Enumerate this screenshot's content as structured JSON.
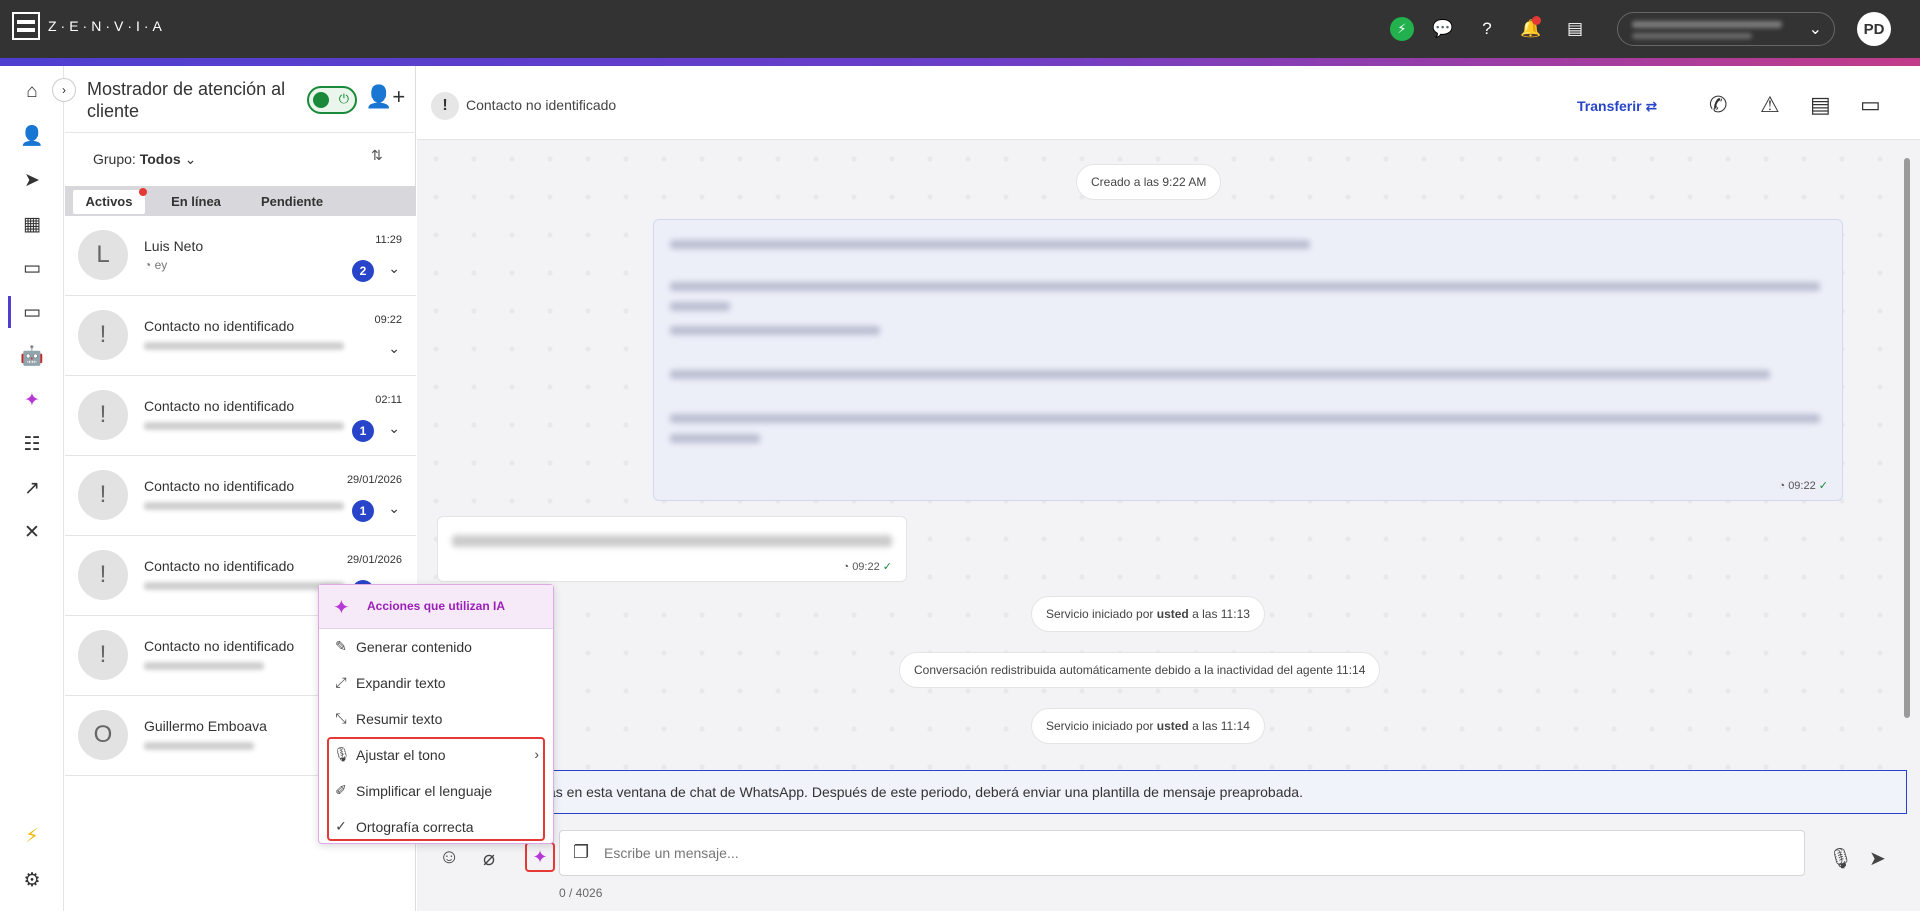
{
  "topbar": {
    "logo_text": "Z·E·N·V·I·A",
    "icons": [
      "lightning-icon",
      "chat-bubbles-icon",
      "help-icon",
      "bell-icon",
      "store-icon"
    ],
    "avatar_initials": "PD",
    "colors": {
      "bar": "#333333",
      "accent_start": "#4e3fd0",
      "accent_end": "#c23c8a"
    }
  },
  "leftnav": {
    "items": [
      "home-icon",
      "contacts-icon",
      "send-icon",
      "document-icon",
      "chat-icon",
      "ticket-icon",
      "robot-icon",
      "ai-sparkle-icon",
      "workflow-icon",
      "analytics-icon",
      "tools-icon"
    ],
    "bottom": [
      "lightning-icon",
      "settings-icon"
    ]
  },
  "list_panel": {
    "title": "Mostrador de atención al cliente",
    "group_label": "Grupo:",
    "group_value": "Todos",
    "tabs": [
      {
        "label": "Activos",
        "active": true,
        "dot": true
      },
      {
        "label": "En línea",
        "active": false
      },
      {
        "label": "Pendiente",
        "active": false
      }
    ],
    "conversations": [
      {
        "initial": "L",
        "name": "Luis Neto",
        "preview": "ey",
        "time": "11:29",
        "badge": "2",
        "channel": "whatsapp"
      },
      {
        "initial": "!",
        "name": "Contacto no identificado",
        "preview": "",
        "time": "09:22",
        "badge": ""
      },
      {
        "initial": "!",
        "name": "Contacto no identificado",
        "preview": "",
        "time": "02:11",
        "badge": "1"
      },
      {
        "initial": "!",
        "name": "Contacto no identificado",
        "preview": "",
        "time": "29/01/2026",
        "badge": "1"
      },
      {
        "initial": "!",
        "name": "Contacto no identificado",
        "preview": "",
        "time": "29/01/2026",
        "badge": "1"
      },
      {
        "initial": "!",
        "name": "Contacto no identificado",
        "preview": "",
        "time": "",
        "badge": ""
      },
      {
        "initial": "O",
        "name": "Guillermo Emboava",
        "preview": "",
        "time": "",
        "badge": ""
      }
    ]
  },
  "chat": {
    "header_title": "Contacto no identificado",
    "transfer_label": "Transferir",
    "header_icons": [
      "phone-icon",
      "alert-icon",
      "archive-icon",
      "ticket-icon"
    ],
    "created_label": "Creado a las 9:22 AM",
    "out_message_time": "09:22",
    "in_message_time": "09:22",
    "system_messages": [
      {
        "prefix": "Servicio iniciado por",
        "bold": "usted",
        "suffix": "a las 11:13"
      },
      {
        "text": "Conversación redistribuida automáticamente debido a la inactividad del agente 11:14"
      },
      {
        "prefix": "Servicio iniciado por",
        "bold": "usted",
        "suffix": "a las 11:14"
      }
    ],
    "notice": "as en esta ventana de chat de WhatsApp. Después de este periodo, deberá enviar una plantilla de mensaje preaprobada.",
    "input_placeholder": "Escribe un mensaje...",
    "char_counter": "0 / 4026"
  },
  "ai_menu": {
    "header": "Acciones que utilizan IA",
    "options": [
      {
        "label": "Generar contenido",
        "icon": "edit-icon"
      },
      {
        "label": "Expandir texto",
        "icon": "expand-icon"
      },
      {
        "label": "Resumir texto",
        "icon": "collapse-icon"
      },
      {
        "label": "Ajustar el tono",
        "icon": "microphone-icon",
        "submenu": true
      },
      {
        "label": "Simplificar el lenguaje",
        "icon": "pen-icon"
      },
      {
        "label": "Ortografía correcta",
        "icon": "spellcheck-icon"
      }
    ],
    "accent": "#b737d6"
  }
}
